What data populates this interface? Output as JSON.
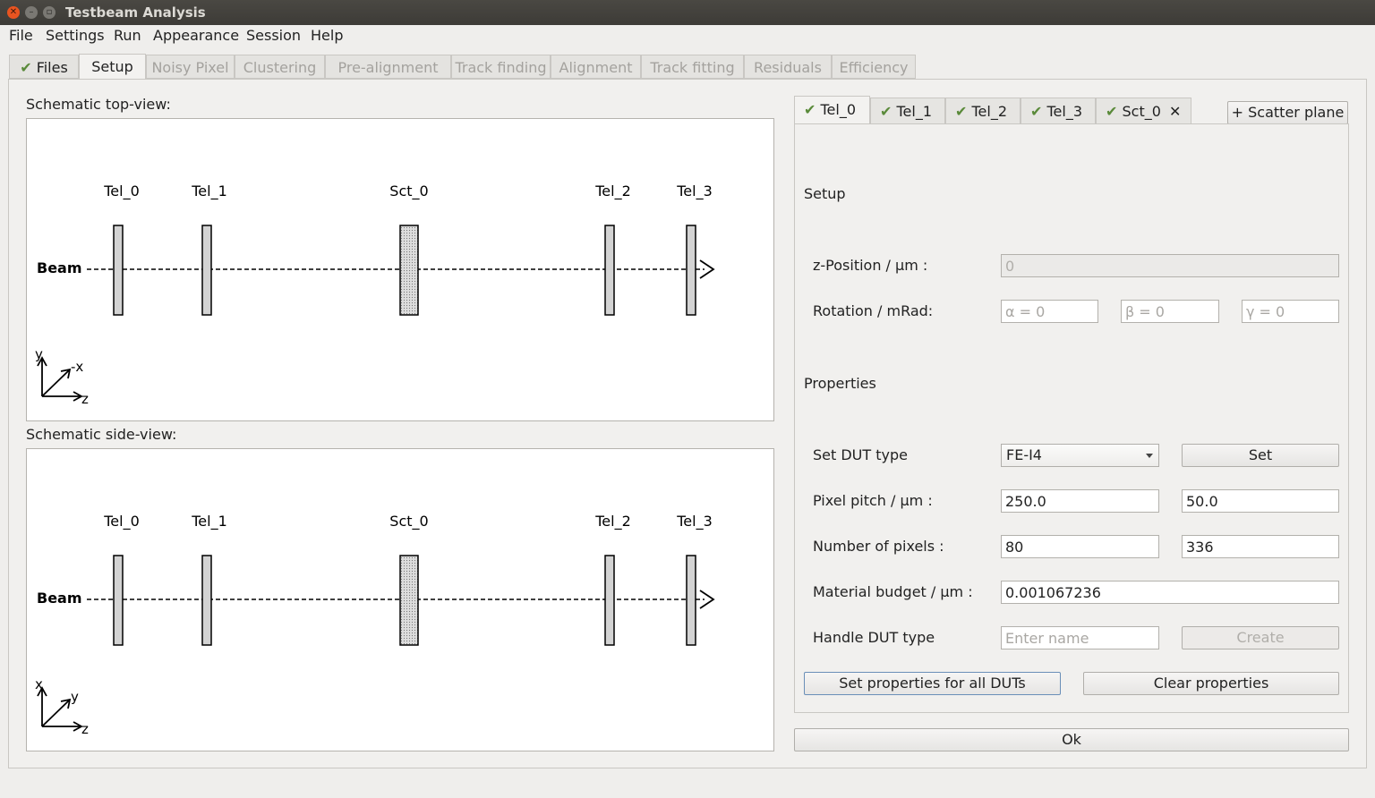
{
  "window": {
    "title": "Testbeam Analysis"
  },
  "menu": [
    "File",
    "Settings",
    "Run",
    "Appearance",
    "Session",
    "Help"
  ],
  "main_tabs": [
    {
      "label": "Files",
      "done": true
    },
    {
      "label": "Setup",
      "active": true
    },
    {
      "label": "Noisy Pixel"
    },
    {
      "label": "Clustering"
    },
    {
      "label": "Pre-alignment"
    },
    {
      "label": "Track finding"
    },
    {
      "label": "Alignment"
    },
    {
      "label": "Track fitting"
    },
    {
      "label": "Residuals"
    },
    {
      "label": "Efficiency"
    }
  ],
  "top_view": {
    "title": "Schematic top-view:",
    "planes": [
      "Tel_0",
      "Tel_1",
      "Sct_0",
      "Tel_2",
      "Tel_3"
    ],
    "beam_label": "Beam",
    "axes": {
      "a": "y",
      "b": "-x",
      "c": "z"
    }
  },
  "side_view": {
    "title": "Schematic side-view:",
    "planes": [
      "Tel_0",
      "Tel_1",
      "Sct_0",
      "Tel_2",
      "Tel_3"
    ],
    "beam_label": "Beam",
    "axes": {
      "a": "x",
      "b": "y",
      "c": "z"
    }
  },
  "dut_tabs": [
    "Tel_0",
    "Tel_1",
    "Tel_2",
    "Tel_3",
    "Sct_0"
  ],
  "scatter_button": "+ Scatter plane",
  "setup": {
    "heading": "Setup",
    "z_label": "z-Position / µm :",
    "z_value": "0",
    "rotation_label": "Rotation / mRad:",
    "alpha_ph": "α = 0",
    "beta_ph": "β = 0",
    "gamma_ph": "γ = 0"
  },
  "properties": {
    "heading": "Properties",
    "dut_type_label": "Set DUT type",
    "dut_type_value": "FE-I4",
    "set_button": "Set",
    "pitch_label": "Pixel pitch / µm :",
    "pitch_x": "250.0",
    "pitch_y": "50.0",
    "pixels_label": "Number of pixels :",
    "pixels_x": "80",
    "pixels_y": "336",
    "material_label": "Material budget / µm :",
    "material_value": "0.001067236",
    "handle_label": "Handle DUT type",
    "name_ph": "Enter name",
    "create_button": "Create",
    "set_all_button": "Set properties for all DUTs",
    "clear_button": "Clear properties"
  },
  "ok_button": "Ok"
}
